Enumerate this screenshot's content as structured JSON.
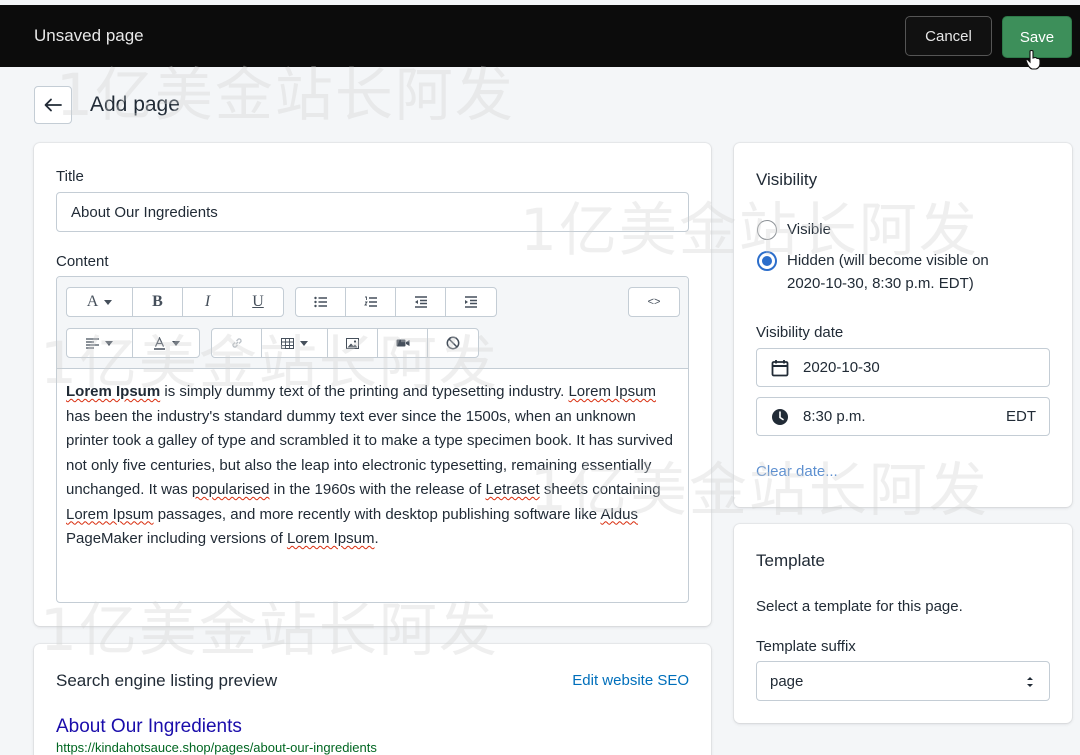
{
  "header": {
    "title": "Unsaved page",
    "cancel_label": "Cancel",
    "save_label": "Save"
  },
  "page": {
    "title": "Add page"
  },
  "form": {
    "title_label": "Title",
    "title_value": "About Our Ingredients",
    "content_label": "Content",
    "toolbar": {
      "font_label": "A",
      "bold": "B",
      "italic": "I",
      "underline": "U",
      "html_toggle": "<>"
    },
    "content": {
      "bold_lead": "Lorem Ipsum",
      "paragraph": [
        {
          "t": "Lorem Ipsum",
          "b": true
        },
        {
          "t": " is simply dummy text of the printing and typesetting industry. "
        },
        {
          "t": "Lorem Ipsum",
          "sq": true
        },
        {
          "t": " has been the industry's standard dummy text ever since the 1500s, when an unknown printer took a galley of type and scrambled it to make a type specimen book. It has survived not only five centuries, but also the leap into electronic typesetting, remaining essentially unchanged. It was "
        },
        {
          "t": "popularised",
          "sq": true
        },
        {
          "t": " in the 1960s with the release of "
        },
        {
          "t": "Letraset",
          "sq": true
        },
        {
          "t": " sheets containing "
        },
        {
          "t": "Lorem Ipsum",
          "sq": true
        },
        {
          "t": " passages, and more recently with desktop publishing software like "
        },
        {
          "t": "Aldus",
          "sq": true
        },
        {
          "t": " PageMaker including versions of "
        },
        {
          "t": "Lorem Ipsum",
          "sq": true
        },
        {
          "t": "."
        }
      ]
    }
  },
  "seo": {
    "heading": "Search engine listing preview",
    "edit_link": "Edit website SEO",
    "preview_title": "About Our Ingredients",
    "preview_url": "https://kindahotsauce.shop/pages/about-our-ingredients"
  },
  "visibility": {
    "heading": "Visibility",
    "option_visible": "Visible",
    "option_hidden_line1": "Hidden (will become visible on",
    "option_hidden_line2": "2020-10-30, 8:30 p.m. EDT)",
    "selected": "hidden",
    "date_label": "Visibility date",
    "date_value": "2020-10-30",
    "time_value": "8:30 p.m.",
    "timezone": "EDT",
    "clear_link": "Clear date..."
  },
  "template": {
    "heading": "Template",
    "description": "Select a template for this page.",
    "suffix_label": "Template suffix",
    "suffix_value": "page"
  },
  "watermark": "1亿美金站长阿发",
  "colors": {
    "topbar": "#0c0c0c",
    "save": "#3d8f5a",
    "link": "#006fbb",
    "radio_selected": "#2c6ecb"
  }
}
